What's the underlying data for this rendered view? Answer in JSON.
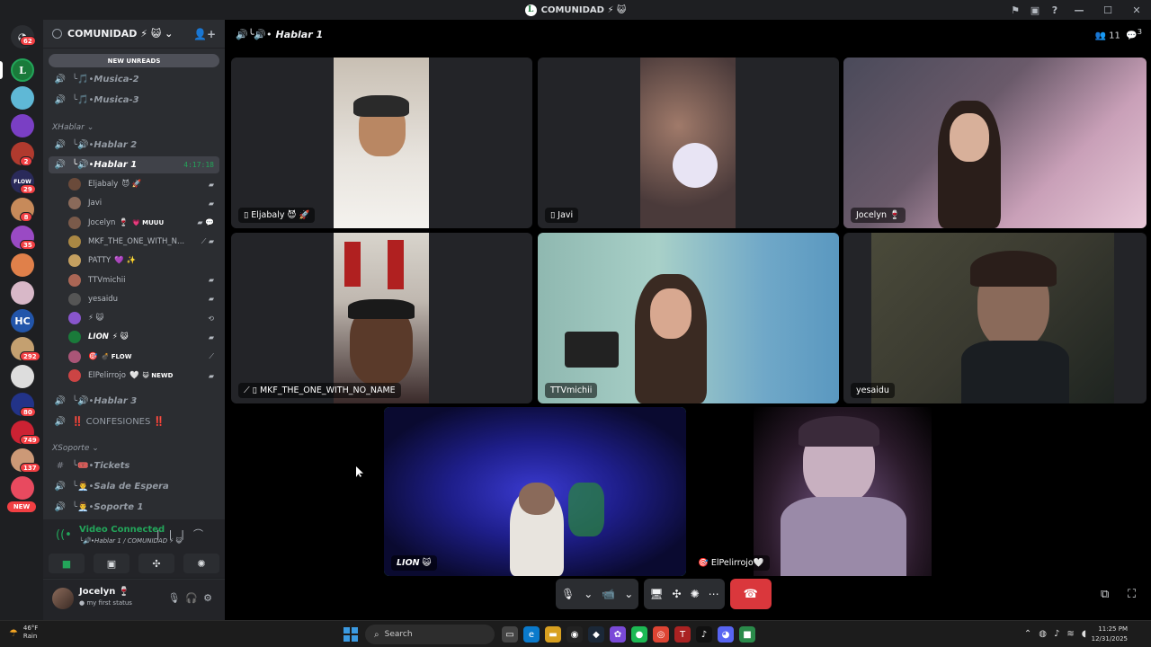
{
  "window": {
    "title": "COMUNIDAD",
    "title_emoji": "⚡ 😺",
    "logo_letter": "L",
    "controls": [
      "⚑",
      "▣",
      "?",
      "—",
      "☐",
      "✕"
    ]
  },
  "rail": {
    "mention_count": "62",
    "new_label": "NEW",
    "servers": [
      {
        "letter": "L",
        "color": "#1a7a3a",
        "badge": ""
      },
      {
        "letter": "",
        "color": "#5fb8d6",
        "badge": ""
      },
      {
        "letter": "",
        "color": "#7a3fc4",
        "badge": ""
      },
      {
        "letter": "",
        "color": "#b03a2e",
        "badge": "2"
      },
      {
        "letter": "FLOW",
        "color": "#2a2a5a",
        "badge": "29"
      },
      {
        "letter": "",
        "color": "#c78a5a",
        "badge": "8"
      },
      {
        "letter": "",
        "color": "#9a4ac4",
        "badge": "35"
      },
      {
        "letter": "",
        "color": "#e0804a",
        "badge": ""
      },
      {
        "letter": "",
        "color": "#d8b8c8",
        "badge": ""
      },
      {
        "letter": "HC",
        "color": "#2255aa",
        "badge": ""
      },
      {
        "letter": "",
        "color": "#c4a070",
        "badge": "292"
      },
      {
        "letter": "",
        "color": "#dddddd",
        "badge": ""
      },
      {
        "letter": "",
        "color": "#223388",
        "badge": "80"
      },
      {
        "letter": "",
        "color": "#cc2233",
        "badge": "749"
      },
      {
        "letter": "",
        "color": "#cc9977",
        "badge": "137"
      },
      {
        "letter": "",
        "color": "#e84a5f",
        "badge": ""
      }
    ]
  },
  "sidebar": {
    "server_name": "COMUNIDAD",
    "server_emoji": "⚡ 😺",
    "new_unreads": "NEW UNREADS",
    "channels_top": [
      {
        "prefix": "╰🎵•",
        "name": "Musica-2"
      },
      {
        "prefix": "╰🎵•",
        "name": "Musica-3"
      }
    ],
    "category_hablar": "Hablar",
    "hablar_2": {
      "prefix": "╰🔊•",
      "name": "Hablar 2"
    },
    "hablar_1": {
      "prefix": "╰🔊•",
      "name": "Hablar 1",
      "timer": "4:17:18"
    },
    "voice_users": [
      {
        "name": "Eljabaly",
        "suffix": "😈 🚀",
        "right": "▰",
        "color": "#6a4a3a"
      },
      {
        "name": "Javi",
        "suffix": "",
        "right": "▰",
        "color": "#8a6a5a"
      },
      {
        "name": "Jocelyn",
        "suffix": "🍷",
        "tag": "💗 MUUU",
        "right": "▰ 💬",
        "color": "#7a5a4a"
      },
      {
        "name": "MKF_THE_ONE_WITH_N...",
        "suffix": "",
        "right": "⟋ ▰",
        "color": "#aa8844"
      },
      {
        "name": "PATTY",
        "suffix": "💜 ✨",
        "right": "",
        "color": "#c4a060"
      },
      {
        "name": "TTVmichii",
        "suffix": "",
        "right": "▰",
        "color": "#aa6655"
      },
      {
        "name": "yesaidu",
        "suffix": "",
        "right": "▰",
        "color": "#555555"
      },
      {
        "name": "⚡ 😺",
        "suffix": "",
        "right": "⟲",
        "color": "#8855cc"
      },
      {
        "name": "LION",
        "suffix": "⚡ 😺",
        "right": "▰",
        "color": "#1a7a3a",
        "bold": true
      },
      {
        "name": "🎯",
        "suffix": "",
        "tag": "💣 FLOW",
        "right": "⟋",
        "color": "#aa5577"
      },
      {
        "name": "ElPelirrojo",
        "suffix": "🤍",
        "tag": "😺 NEWD",
        "right": "▰",
        "color": "#cc4444"
      }
    ],
    "hablar_3": {
      "prefix": "╰🔊•",
      "name": "Hablar 3"
    },
    "confesiones": {
      "name": "‼️ CONFESIONES ‼️"
    },
    "category_soporte": "Soporte",
    "soporte_channels": [
      {
        "prefix": "╰🎟️•",
        "name": "Tickets",
        "hash": "#"
      },
      {
        "prefix": "╰👨‍💼•",
        "name": "Sala de Espera",
        "hash": "🔊"
      },
      {
        "prefix": "╰👨‍💼•",
        "name": "Soporte 1",
        "hash": "🔊"
      }
    ]
  },
  "voice_panel": {
    "status": "Video Connected",
    "location": "╰🔊•Hablar 1 / COMUNIDAD ⚡ 😺"
  },
  "user_panel": {
    "name": "Jocelyn",
    "name_emoji": "🍷",
    "status": "my first status"
  },
  "main": {
    "channel_prefix": "╰🔊•",
    "channel_name": "Hablar 1",
    "member_count": "11",
    "notify_count": "3",
    "tiles": [
      {
        "name": "Eljabaly",
        "suffix": "😈 🚀",
        "device": "▯"
      },
      {
        "name": "Javi",
        "suffix": "",
        "device": "▯"
      },
      {
        "name": "Jocelyn",
        "suffix": "🍷",
        "device": ""
      },
      {
        "name": "MKF_THE_ONE_WITH_NO_NAME",
        "suffix": "",
        "device": "⟋ ▯"
      },
      {
        "name": "TTVmichii",
        "suffix": "",
        "device": ""
      },
      {
        "name": "yesaidu",
        "suffix": "",
        "device": ""
      },
      {
        "name": "LION",
        "suffix": "😺",
        "device": ""
      },
      {
        "name": "ElPelirrojo",
        "suffix": "🤍",
        "device": "🎯"
      }
    ]
  },
  "controls": {
    "mic": "🎙",
    "camera": "📹",
    "screen": "🖥",
    "activities": "✣",
    "soundboard": "✺",
    "more": "⋯",
    "hangup": "☎",
    "popout": "⧉",
    "fullscreen": "⛶"
  },
  "taskbar": {
    "weather_temp": "46°F",
    "weather_desc": "Rain",
    "search_placeholder": "Search",
    "time": "11:25 PM",
    "date": "12/31/2025",
    "apps": [
      {
        "icon": "▭",
        "color": "#444"
      },
      {
        "icon": "e",
        "color": "#0a7acc"
      },
      {
        "icon": "▬",
        "color": "#d8a020"
      },
      {
        "icon": "◉",
        "color": "#222"
      },
      {
        "icon": "◆",
        "color": "#1b2838"
      },
      {
        "icon": "✿",
        "color": "#7a4ad8"
      },
      {
        "icon": "●",
        "color": "#1db954"
      },
      {
        "icon": "◎",
        "color": "#dd4433"
      },
      {
        "icon": "T",
        "color": "#aa2222"
      },
      {
        "icon": "♪",
        "color": "#111"
      },
      {
        "icon": "◕",
        "color": "#5865f2"
      },
      {
        "icon": "■",
        "color": "#2a8a4a"
      }
    ]
  }
}
